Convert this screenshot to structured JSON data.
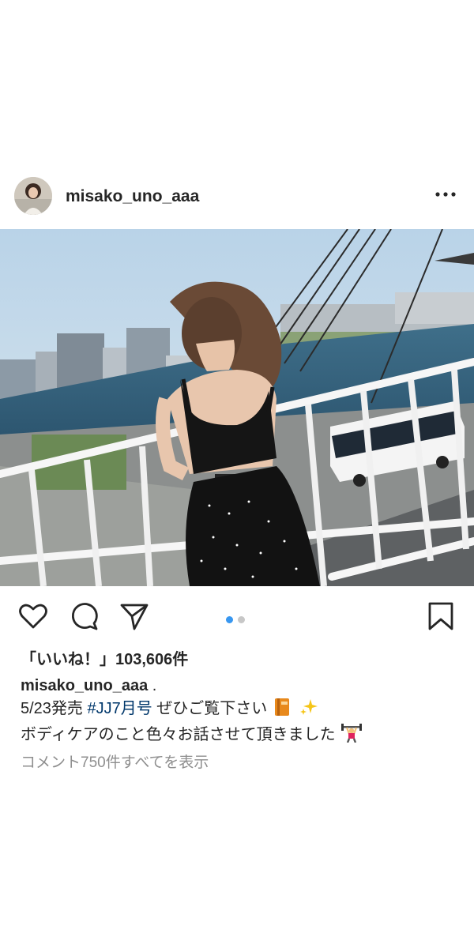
{
  "post": {
    "username": "misako_uno_aaa",
    "likes_text": "「いいね！」103,606件",
    "caption": {
      "username": "misako_uno_aaa",
      "line1_end": " .",
      "line2_prefix": "5/23発売 ",
      "hashtag": "#JJ7月号",
      "line2_suffix": " ぜひご覧下さい",
      "line3": "ボディケアのこと色々お話させて頂きました"
    },
    "view_comments": "コメント750件すべてを表示"
  },
  "carousel": {
    "total": 2,
    "current": 1,
    "active_color": "#3897f0",
    "inactive_color": "#c7c7c7"
  },
  "icons": [
    "more-icon",
    "heart-icon",
    "comment-icon",
    "share-icon",
    "bookmark-icon",
    "book-emoji-icon",
    "sparkles-emoji-icon",
    "weightlifter-emoji-icon"
  ]
}
